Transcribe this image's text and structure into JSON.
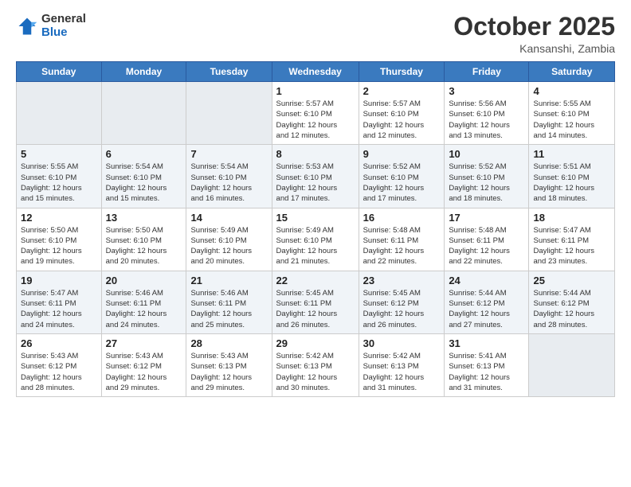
{
  "header": {
    "logo_line1": "General",
    "logo_line2": "Blue",
    "month_year": "October 2025",
    "location": "Kansanshi, Zambia"
  },
  "weekdays": [
    "Sunday",
    "Monday",
    "Tuesday",
    "Wednesday",
    "Thursday",
    "Friday",
    "Saturday"
  ],
  "rows": [
    [
      {
        "day": "",
        "info": ""
      },
      {
        "day": "",
        "info": ""
      },
      {
        "day": "",
        "info": ""
      },
      {
        "day": "1",
        "info": "Sunrise: 5:57 AM\nSunset: 6:10 PM\nDaylight: 12 hours\nand 12 minutes."
      },
      {
        "day": "2",
        "info": "Sunrise: 5:57 AM\nSunset: 6:10 PM\nDaylight: 12 hours\nand 12 minutes."
      },
      {
        "day": "3",
        "info": "Sunrise: 5:56 AM\nSunset: 6:10 PM\nDaylight: 12 hours\nand 13 minutes."
      },
      {
        "day": "4",
        "info": "Sunrise: 5:55 AM\nSunset: 6:10 PM\nDaylight: 12 hours\nand 14 minutes."
      }
    ],
    [
      {
        "day": "5",
        "info": "Sunrise: 5:55 AM\nSunset: 6:10 PM\nDaylight: 12 hours\nand 15 minutes."
      },
      {
        "day": "6",
        "info": "Sunrise: 5:54 AM\nSunset: 6:10 PM\nDaylight: 12 hours\nand 15 minutes."
      },
      {
        "day": "7",
        "info": "Sunrise: 5:54 AM\nSunset: 6:10 PM\nDaylight: 12 hours\nand 16 minutes."
      },
      {
        "day": "8",
        "info": "Sunrise: 5:53 AM\nSunset: 6:10 PM\nDaylight: 12 hours\nand 17 minutes."
      },
      {
        "day": "9",
        "info": "Sunrise: 5:52 AM\nSunset: 6:10 PM\nDaylight: 12 hours\nand 17 minutes."
      },
      {
        "day": "10",
        "info": "Sunrise: 5:52 AM\nSunset: 6:10 PM\nDaylight: 12 hours\nand 18 minutes."
      },
      {
        "day": "11",
        "info": "Sunrise: 5:51 AM\nSunset: 6:10 PM\nDaylight: 12 hours\nand 18 minutes."
      }
    ],
    [
      {
        "day": "12",
        "info": "Sunrise: 5:50 AM\nSunset: 6:10 PM\nDaylight: 12 hours\nand 19 minutes."
      },
      {
        "day": "13",
        "info": "Sunrise: 5:50 AM\nSunset: 6:10 PM\nDaylight: 12 hours\nand 20 minutes."
      },
      {
        "day": "14",
        "info": "Sunrise: 5:49 AM\nSunset: 6:10 PM\nDaylight: 12 hours\nand 20 minutes."
      },
      {
        "day": "15",
        "info": "Sunrise: 5:49 AM\nSunset: 6:10 PM\nDaylight: 12 hours\nand 21 minutes."
      },
      {
        "day": "16",
        "info": "Sunrise: 5:48 AM\nSunset: 6:11 PM\nDaylight: 12 hours\nand 22 minutes."
      },
      {
        "day": "17",
        "info": "Sunrise: 5:48 AM\nSunset: 6:11 PM\nDaylight: 12 hours\nand 22 minutes."
      },
      {
        "day": "18",
        "info": "Sunrise: 5:47 AM\nSunset: 6:11 PM\nDaylight: 12 hours\nand 23 minutes."
      }
    ],
    [
      {
        "day": "19",
        "info": "Sunrise: 5:47 AM\nSunset: 6:11 PM\nDaylight: 12 hours\nand 24 minutes."
      },
      {
        "day": "20",
        "info": "Sunrise: 5:46 AM\nSunset: 6:11 PM\nDaylight: 12 hours\nand 24 minutes."
      },
      {
        "day": "21",
        "info": "Sunrise: 5:46 AM\nSunset: 6:11 PM\nDaylight: 12 hours\nand 25 minutes."
      },
      {
        "day": "22",
        "info": "Sunrise: 5:45 AM\nSunset: 6:11 PM\nDaylight: 12 hours\nand 26 minutes."
      },
      {
        "day": "23",
        "info": "Sunrise: 5:45 AM\nSunset: 6:12 PM\nDaylight: 12 hours\nand 26 minutes."
      },
      {
        "day": "24",
        "info": "Sunrise: 5:44 AM\nSunset: 6:12 PM\nDaylight: 12 hours\nand 27 minutes."
      },
      {
        "day": "25",
        "info": "Sunrise: 5:44 AM\nSunset: 6:12 PM\nDaylight: 12 hours\nand 28 minutes."
      }
    ],
    [
      {
        "day": "26",
        "info": "Sunrise: 5:43 AM\nSunset: 6:12 PM\nDaylight: 12 hours\nand 28 minutes."
      },
      {
        "day": "27",
        "info": "Sunrise: 5:43 AM\nSunset: 6:12 PM\nDaylight: 12 hours\nand 29 minutes."
      },
      {
        "day": "28",
        "info": "Sunrise: 5:43 AM\nSunset: 6:13 PM\nDaylight: 12 hours\nand 29 minutes."
      },
      {
        "day": "29",
        "info": "Sunrise: 5:42 AM\nSunset: 6:13 PM\nDaylight: 12 hours\nand 30 minutes."
      },
      {
        "day": "30",
        "info": "Sunrise: 5:42 AM\nSunset: 6:13 PM\nDaylight: 12 hours\nand 31 minutes."
      },
      {
        "day": "31",
        "info": "Sunrise: 5:41 AM\nSunset: 6:13 PM\nDaylight: 12 hours\nand 31 minutes."
      },
      {
        "day": "",
        "info": ""
      }
    ]
  ]
}
